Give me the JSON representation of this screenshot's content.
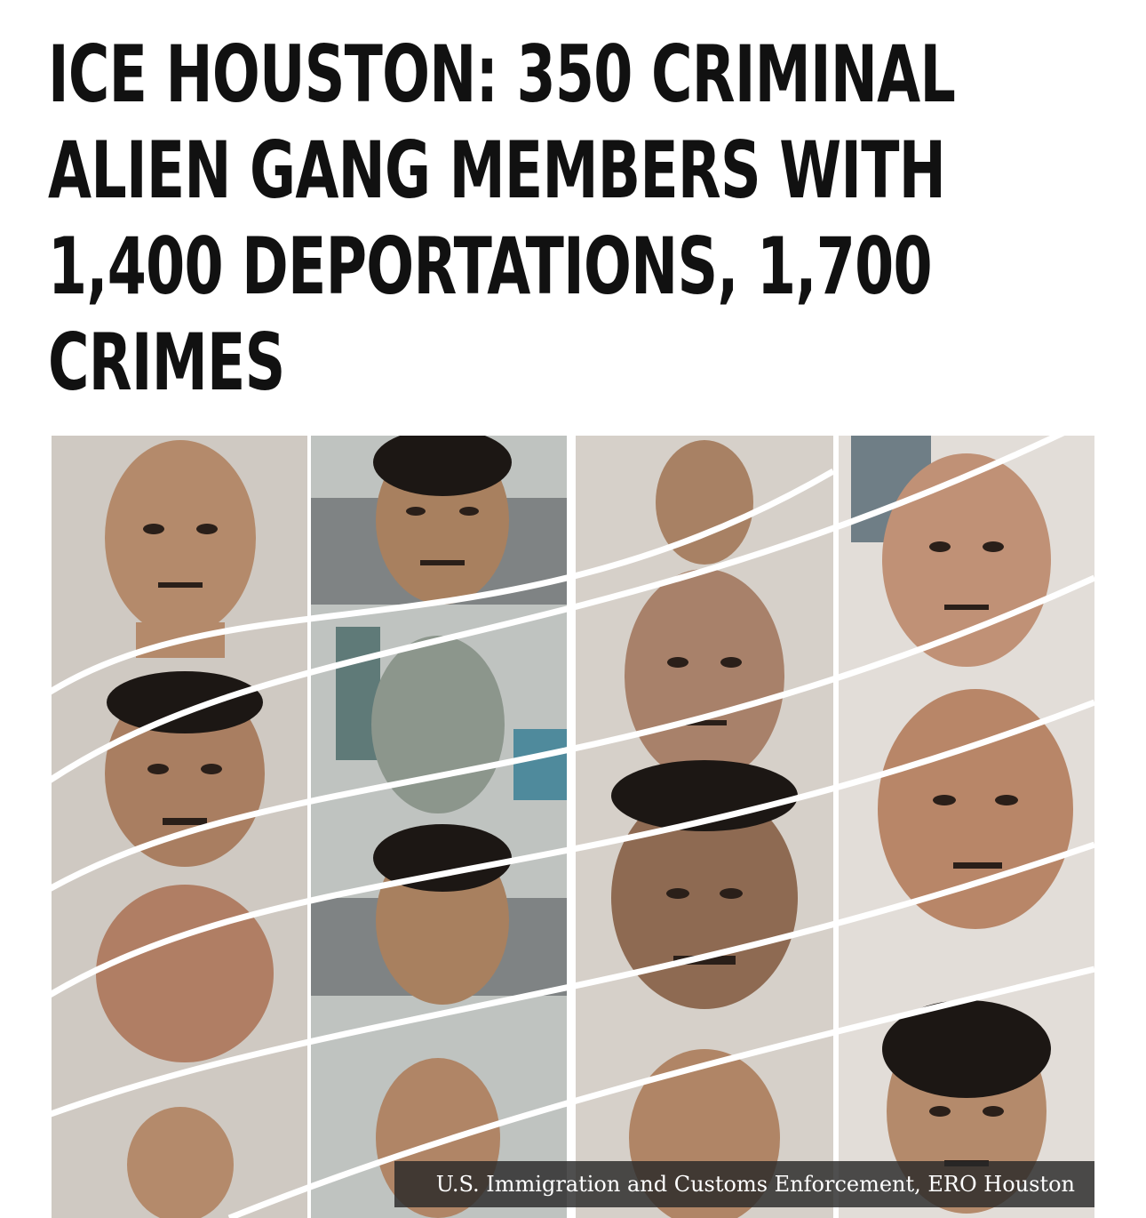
{
  "article": {
    "headline_lines": [
      "ICE HOUSTON: 350 CRIMINAL",
      "ALIEN GANG MEMBERS WITH",
      "1,400 DEPORTATIONS, 1,700",
      "CRIMES"
    ]
  },
  "photo": {
    "caption": "U.S. Immigration and Customs Enforcement, ERO Houston",
    "colors": {
      "skin": "#b3896a",
      "skin_dark": "#8e6a52",
      "hair": "#1c1714",
      "divider": "#ffffff",
      "caption_bg": "#282828"
    }
  }
}
